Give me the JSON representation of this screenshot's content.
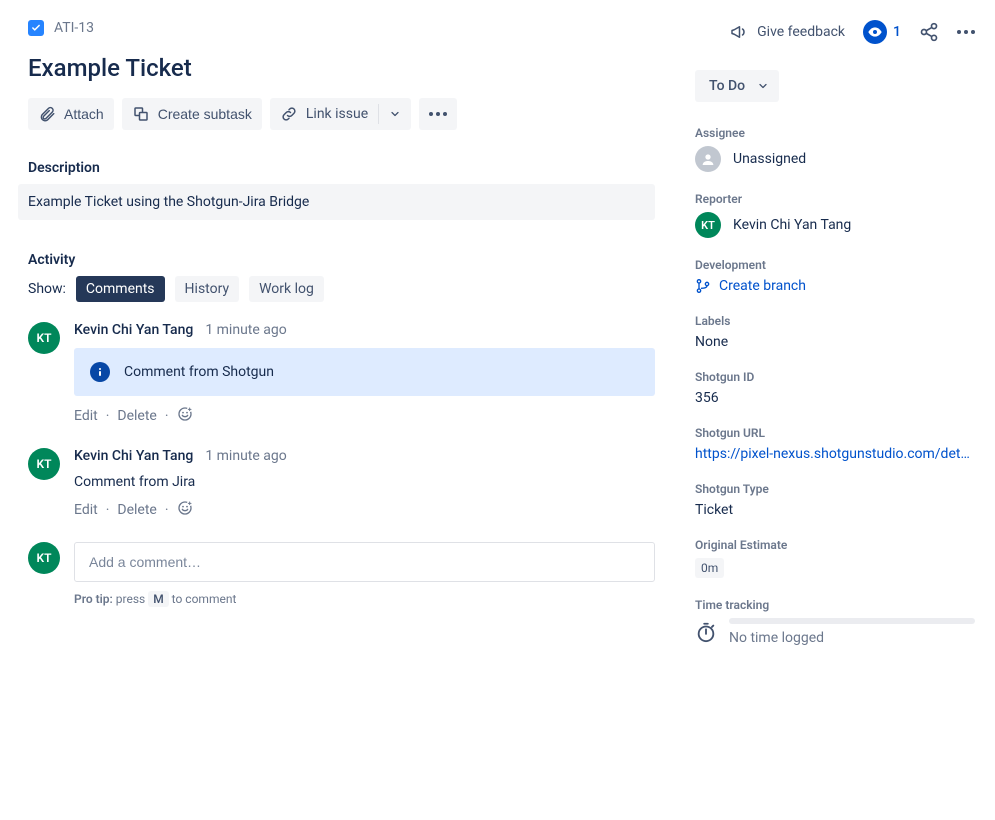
{
  "header": {
    "issue_key": "ATI-13",
    "feedback_label": "Give feedback",
    "watch_count": "1"
  },
  "issue": {
    "title": "Example Ticket"
  },
  "toolbar": {
    "attach": "Attach",
    "create_subtask": "Create subtask",
    "link_issue": "Link issue"
  },
  "description": {
    "label": "Description",
    "value": "Example Ticket using the Shotgun-Jira Bridge"
  },
  "activity": {
    "label": "Activity",
    "show": "Show:",
    "tabs": {
      "comments": "Comments",
      "history": "History",
      "worklog": "Work log"
    }
  },
  "comments": [
    {
      "author": "Kevin Chi Yan Tang",
      "initials": "KT",
      "time": "1 minute ago",
      "body": "Comment from Shotgun",
      "panel": true,
      "edit": "Edit",
      "delete": "Delete"
    },
    {
      "author": "Kevin Chi Yan Tang",
      "initials": "KT",
      "time": "1 minute ago",
      "body": "Comment from Jira",
      "panel": false,
      "edit": "Edit",
      "delete": "Delete"
    }
  ],
  "add_comment": {
    "initials": "KT",
    "placeholder": "Add a comment…",
    "tip_bold": "Pro tip:",
    "tip_press": " press ",
    "tip_key": "M",
    "tip_rest": " to comment"
  },
  "side": {
    "status_label": "To Do",
    "assignee": {
      "label": "Assignee",
      "value": "Unassigned"
    },
    "reporter": {
      "label": "Reporter",
      "value": "Kevin Chi Yan Tang",
      "initials": "KT"
    },
    "development": {
      "label": "Development",
      "create_branch": "Create branch"
    },
    "labels": {
      "label": "Labels",
      "value": "None"
    },
    "shotgun_id": {
      "label": "Shotgun ID",
      "value": "356"
    },
    "shotgun_url": {
      "label": "Shotgun URL",
      "value": "https://pixel-nexus.shotgunstudio.com/detai…"
    },
    "shotgun_type": {
      "label": "Shotgun Type",
      "value": "Ticket"
    },
    "original_estimate": {
      "label": "Original Estimate",
      "value": "0m"
    },
    "time_tracking": {
      "label": "Time tracking",
      "value": "No time logged"
    }
  }
}
